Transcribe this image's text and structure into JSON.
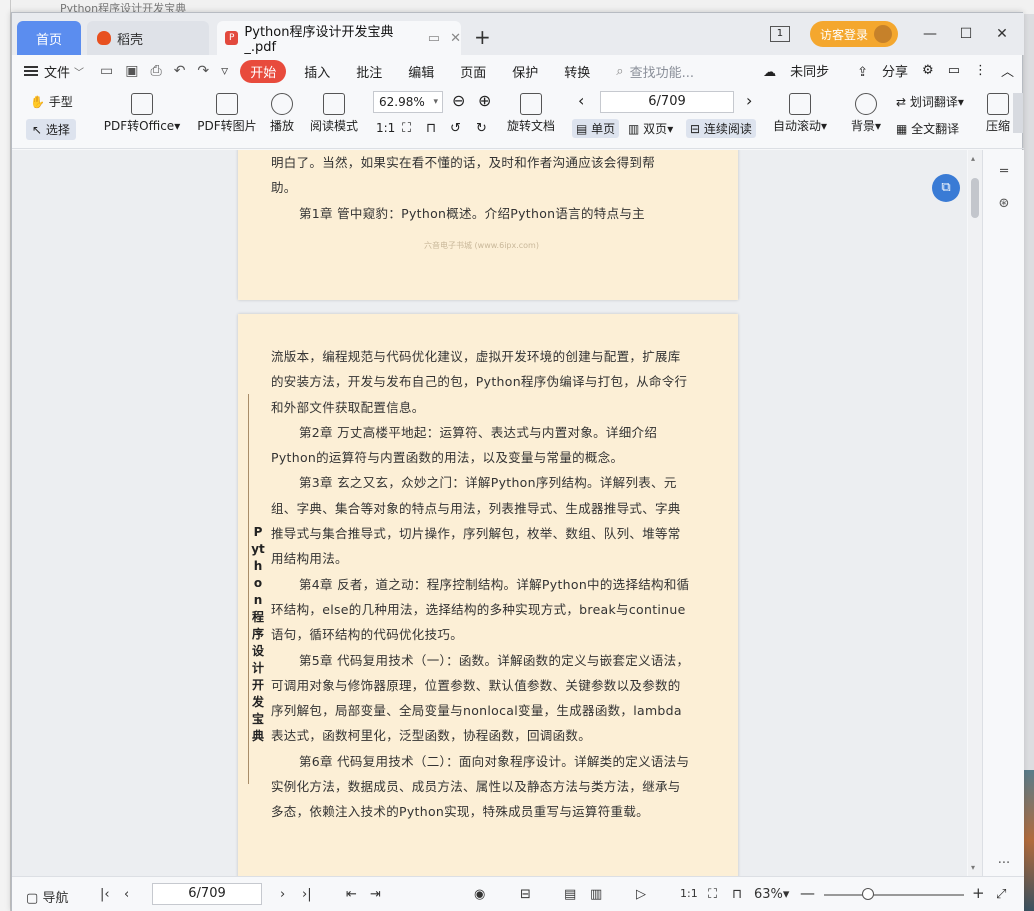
{
  "window": {
    "background_title": "Python程序设计开发宝典",
    "tabs": [
      {
        "label": "首页"
      },
      {
        "label": "稻壳"
      },
      {
        "label": "Python程序设计开发宝典_.pdf"
      }
    ],
    "visitor_login": "访客登录",
    "num_badge": "1"
  },
  "menu": {
    "file": "文件",
    "start": "开始",
    "items": [
      "插入",
      "批注",
      "编辑",
      "页面",
      "保护",
      "转换"
    ],
    "search_placeholder": "查找功能...",
    "sync": "未同步",
    "share": "分享"
  },
  "ribbon": {
    "hand": "手型",
    "select": "选择",
    "pdf_to_office": "PDF转Office",
    "pdf_to_image": "PDF转图片",
    "play": "播放",
    "read_mode": "阅读模式",
    "zoom": "62.98%",
    "rotate": "旋转文档",
    "page_value": "6/709",
    "single_page": "单页",
    "double_page": "双页",
    "continuous": "连续阅读",
    "auto_scroll": "自动滚动",
    "background": "背景",
    "word_translate": "划词翻译",
    "full_translate": "全文翻译",
    "compress": "压缩"
  },
  "page1": {
    "lines": [
      "明白了。当然，如果实在看不懂的话，及时和作者沟通应该会得到帮",
      "助。"
    ],
    "ch1": "第1章 管中窥豹：Python概述。介绍Python语言的特点与主",
    "watermark": "六音电子书城 (www.6ipx.com)"
  },
  "page2": {
    "paragraphs": [
      "流版本，编程规范与代码优化建议，虚拟开发环境的创建与配置，扩展库的安装方法，开发与发布自己的包，Python程序伪编译与打包，从命令行和外部文件获取配置信息。",
      "第2章 万丈高楼平地起：运算符、表达式与内置对象。详细介绍Python的运算符与内置函数的用法，以及变量与常量的概念。",
      "第3章 玄之又玄，众妙之门：详解Python序列结构。详解列表、元组、字典、集合等对象的特点与用法，列表推导式、生成器推导式、字典推导式与集合推导式，切片操作，序列解包，枚举、数组、队列、堆等常用结构用法。",
      "第4章 反者，道之动：程序控制结构。详解Python中的选择结构和循环结构，else的几种用法，选择结构的多种实现方式，break与continue语句，循环结构的代码优化技巧。",
      "第5章 代码复用技术（一）：函数。详解函数的定义与嵌套定义语法，可调用对象与修饰器原理，位置参数、默认值参数、关键参数以及参数的序列解包，局部变量、全局变量与nonlocal变量，生成器函数，lambda表达式，函数柯里化，泛型函数，协程函数，回调函数。",
      "第6章 代码复用技术（二）：面向对象程序设计。详解类的定义语法与实例化方法，数据成员、成员方法、属性以及静态方法与类方法，继承与多态，依赖注入技术的Python实现，特殊成员重写与运算符重载。"
    ],
    "spine": "Python程序设计开发宝典"
  },
  "statusbar": {
    "nav": "导航",
    "page_value": "6/709",
    "zoom": "63%"
  }
}
